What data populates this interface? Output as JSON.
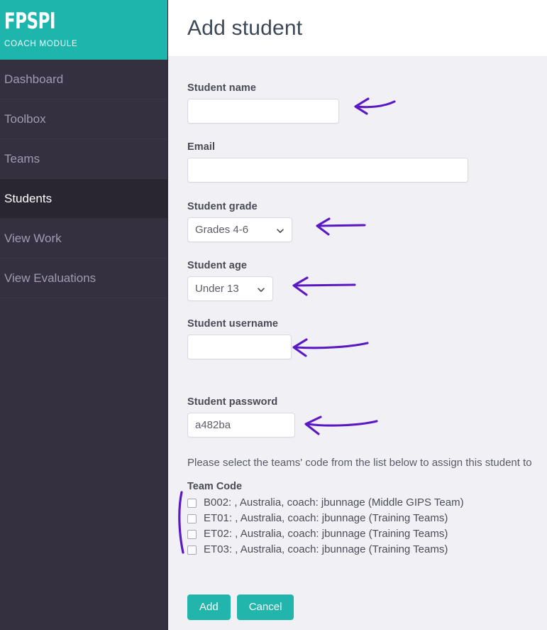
{
  "sidebar": {
    "brand": {
      "logo": "FPSPI",
      "subtitle": "COACH MODULE"
    },
    "items": [
      {
        "label": "Dashboard",
        "active": false
      },
      {
        "label": "Toolbox",
        "active": false
      },
      {
        "label": "Teams",
        "active": false
      },
      {
        "label": "Students",
        "active": true
      },
      {
        "label": "View Work",
        "active": false
      },
      {
        "label": "View Evaluations",
        "active": false
      }
    ]
  },
  "header": {
    "title": "Add student"
  },
  "form": {
    "student_name": {
      "label": "Student name",
      "value": "",
      "placeholder": ""
    },
    "email": {
      "label": "Email",
      "value": "",
      "placeholder": ""
    },
    "student_grade": {
      "label": "Student grade",
      "value": "Grades 4-6"
    },
    "student_age": {
      "label": "Student age",
      "value": "Under 13"
    },
    "student_username": {
      "label": "Student username",
      "value": "",
      "placeholder": ""
    },
    "student_password": {
      "label": "Student password",
      "value": "a482ba",
      "placeholder": ""
    },
    "instruction": "Please select the teams' code from the list below to assign this student to",
    "team_code_heading": "Team Code",
    "teams": [
      {
        "label": "B002: , Australia, coach: jbunnage (Middle GIPS Team)",
        "checked": false
      },
      {
        "label": "ET01: , Australia, coach: jbunnage (Training Teams)",
        "checked": false
      },
      {
        "label": "ET02: , Australia, coach: jbunnage (Training Teams)",
        "checked": false
      },
      {
        "label": "ET03: , Australia, coach: jbunnage (Training Teams)",
        "checked": false
      }
    ],
    "add_button": "Add",
    "cancel_button": "Cancel"
  },
  "colors": {
    "brand_teal": "#1eb5ac",
    "sidebar_bg": "#343040",
    "sidebar_active_bg": "#2a2631",
    "content_bg": "#f0f0f5",
    "annotation_purple": "#5b19c4"
  },
  "annotations": {
    "arrow_student_name": "arrow pointing left at student name field",
    "arrow_student_grade": "arrow pointing left at student grade select",
    "arrow_student_age": "arrow pointing left at student age select",
    "arrow_student_username": "arrow pointing left at student username field",
    "arrow_student_password": "arrow pointing left at student password field",
    "bracket_team_list": "vertical bracket beside team code checkbox list"
  }
}
